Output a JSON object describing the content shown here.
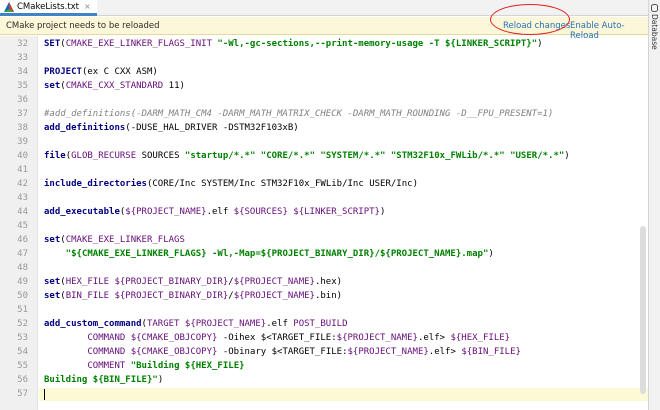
{
  "tab": {
    "label": "CMakeLists.txt",
    "close": "×"
  },
  "notification": {
    "message": "CMake project needs to be reloaded",
    "reload_label": "Reload changes",
    "auto_reload_label": "Enable Auto-Reload"
  },
  "right_panel": {
    "label": "Database"
  },
  "editor": {
    "lines": [
      {
        "num": "32",
        "text": "SET(CMAKE_EXE_LINKER_FLAGS_INIT \"-Wl,-gc-sections,--print-memory-usage -T ${LINKER_SCRIPT}\")"
      },
      {
        "num": "33",
        "text": ""
      },
      {
        "num": "34",
        "text": "PROJECT(ex C CXX ASM)"
      },
      {
        "num": "35",
        "text": "set(CMAKE_CXX_STANDARD 11)"
      },
      {
        "num": "36",
        "text": ""
      },
      {
        "num": "37",
        "text": "#add_definitions(-DARM_MATH_CM4 -DARM_MATH_MATRIX_CHECK -DARM_MATH_ROUNDING -D__FPU_PRESENT=1)"
      },
      {
        "num": "38",
        "text": "add_definitions(-DUSE_HAL_DRIVER -DSTM32F103xB)"
      },
      {
        "num": "39",
        "text": ""
      },
      {
        "num": "40",
        "text": "file(GLOB_RECURSE SOURCES \"startup/*.*\" \"CORE/*.*\" \"SYSTEM/*.*\" \"STM32F10x_FWLib/*.*\" \"USER/*.*\")"
      },
      {
        "num": "41",
        "text": ""
      },
      {
        "num": "42",
        "text": "include_directories(CORE/Inc SYSTEM/Inc STM32F10x_FWLib/Inc USER/Inc)"
      },
      {
        "num": "43",
        "text": ""
      },
      {
        "num": "44",
        "text": "add_executable(${PROJECT_NAME}.elf ${SOURCES} ${LINKER_SCRIPT})"
      },
      {
        "num": "45",
        "text": ""
      },
      {
        "num": "46",
        "text": "set(CMAKE_EXE_LINKER_FLAGS"
      },
      {
        "num": "47",
        "text": "    \"${CMAKE_EXE_LINKER_FLAGS} -Wl,-Map=${PROJECT_BINARY_DIR}/${PROJECT_NAME}.map\")"
      },
      {
        "num": "48",
        "text": ""
      },
      {
        "num": "49",
        "text": "set(HEX_FILE ${PROJECT_BINARY_DIR}/${PROJECT_NAME}.hex)"
      },
      {
        "num": "50",
        "text": "set(BIN_FILE ${PROJECT_BINARY_DIR}/${PROJECT_NAME}.bin)"
      },
      {
        "num": "51",
        "text": ""
      },
      {
        "num": "52",
        "text": "add_custom_command(TARGET ${PROJECT_NAME}.elf POST_BUILD"
      },
      {
        "num": "53",
        "text": "        COMMAND ${CMAKE_OBJCOPY} -Oihex $<TARGET_FILE:${PROJECT_NAME}.elf> ${HEX_FILE}"
      },
      {
        "num": "54",
        "text": "        COMMAND ${CMAKE_OBJCOPY} -Obinary $<TARGET_FILE:${PROJECT_NAME}.elf> ${BIN_FILE}"
      },
      {
        "num": "55",
        "text": "        COMMENT \"Building ${HEX_FILE}"
      },
      {
        "num": "56",
        "text": "Building ${BIN_FILE}\")"
      },
      {
        "num": "57",
        "text": ""
      }
    ]
  },
  "colors": {
    "keyword": "#000080",
    "string": "#008000",
    "variable": "#660e7a",
    "comment": "#808080",
    "link": "#2470b3",
    "notification_bg": "#fdf7d9",
    "annotation_circle": "#e02020"
  }
}
